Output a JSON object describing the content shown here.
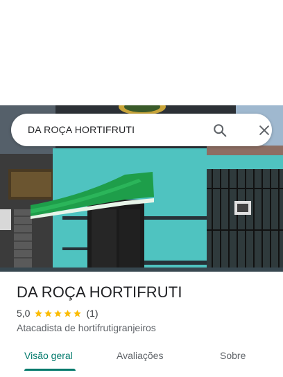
{
  "search": {
    "query": "DA ROÇA HORTIFRUTI"
  },
  "place": {
    "name": "DA ROÇA HORTIFRUTI",
    "rating": "5,0",
    "stars": 5,
    "review_count": "(1)",
    "category": "Atacadista de hortifrutigranjeiros"
  },
  "tabs": [
    {
      "label": "Visão geral",
      "active": true
    },
    {
      "label": "Avaliações",
      "active": false
    },
    {
      "label": "Sobre",
      "active": false
    }
  ],
  "colors": {
    "accent": "#00796b",
    "star": "#fbbc04",
    "wall": "#4fc3c0",
    "awning": "#1e9e4a"
  },
  "icons": {
    "search": "search-icon",
    "close": "close-icon",
    "star": "star-icon"
  }
}
